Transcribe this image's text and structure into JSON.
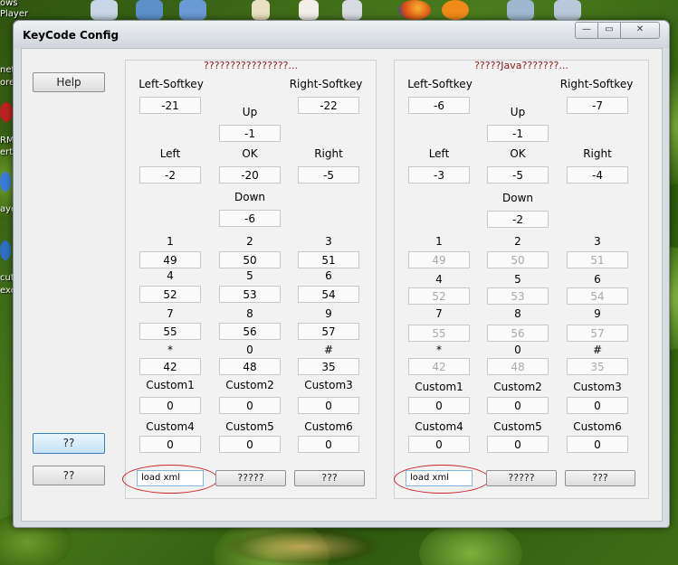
{
  "desktop": {
    "labels": [
      "ows",
      "Player",
      "net",
      "ore",
      "RM",
      "erte",
      "aye",
      "cut",
      "exe"
    ]
  },
  "window": {
    "title": "KeyCode Config",
    "min_glyph": "—",
    "max_glyph": "▭",
    "close_glyph": "✕"
  },
  "left_buttons": {
    "help": "Help",
    "btn2": "??",
    "btn3": "??"
  },
  "panel_left": {
    "title": "????????????????...",
    "labels": {
      "left_softkey": "Left-Softkey",
      "right_softkey": "Right-Softkey",
      "up": "Up",
      "left": "Left",
      "ok": "OK",
      "right": "Right",
      "down": "Down",
      "k1": "1",
      "k2": "2",
      "k3": "3",
      "k4": "4",
      "k5": "5",
      "k6": "6",
      "k7": "7",
      "k8": "8",
      "k9": "9",
      "star": "*",
      "k0": "0",
      "hash": "#",
      "custom1": "Custom1",
      "custom2": "Custom2",
      "custom3": "Custom3",
      "custom4": "Custom4",
      "custom5": "Custom5",
      "custom6": "Custom6"
    },
    "values": {
      "left_softkey": "-21",
      "right_softkey": "-22",
      "up": "-1",
      "left": "-2",
      "ok": "-20",
      "right": "-5",
      "down": "-6",
      "k1": "49",
      "k2": "50",
      "k3": "51",
      "k4": "52",
      "k5": "53",
      "k6": "54",
      "k7": "55",
      "k8": "56",
      "k9": "57",
      "star": "42",
      "k0": "48",
      "hash": "35",
      "custom1": "0",
      "custom2": "0",
      "custom3": "0",
      "custom4": "0",
      "custom5": "0",
      "custom6": "0"
    },
    "load_xml": "load xml",
    "btn_mid": "?????",
    "btn_right": "???"
  },
  "panel_right": {
    "title": "?????Java???????...",
    "labels": {
      "left_softkey": "Left-Softkey",
      "right_softkey": "Right-Softkey",
      "up": "Up",
      "left": "Left",
      "ok": "OK",
      "right": "Right",
      "down": "Down",
      "k1": "1",
      "k2": "2",
      "k3": "3",
      "k4": "4",
      "k5": "5",
      "k6": "6",
      "k7": "7",
      "k8": "8",
      "k9": "9",
      "star": "*",
      "k0": "0",
      "hash": "#",
      "custom1": "Custom1",
      "custom2": "Custom2",
      "custom3": "Custom3",
      "custom4": "Custom4",
      "custom5": "Custom5",
      "custom6": "Custom6"
    },
    "values": {
      "left_softkey": "-6",
      "right_softkey": "-7",
      "up": "-1",
      "left": "-3",
      "ok": "-5",
      "right": "-4",
      "down": "-2",
      "k1": "49",
      "k2": "50",
      "k3": "51",
      "k4": "52",
      "k5": "53",
      "k6": "54",
      "k7": "55",
      "k8": "56",
      "k9": "57",
      "star": "42",
      "k0": "48",
      "hash": "35",
      "custom1": "0",
      "custom2": "0",
      "custom3": "0",
      "custom4": "0",
      "custom5": "0",
      "custom6": "0"
    },
    "load_xml": "load xml",
    "btn_mid": "?????",
    "btn_right": "???"
  },
  "colors": {
    "annotation_circle": "#cc2222",
    "panel_title": "#8b1a1a",
    "disabled_text": "#aaaaaa"
  }
}
